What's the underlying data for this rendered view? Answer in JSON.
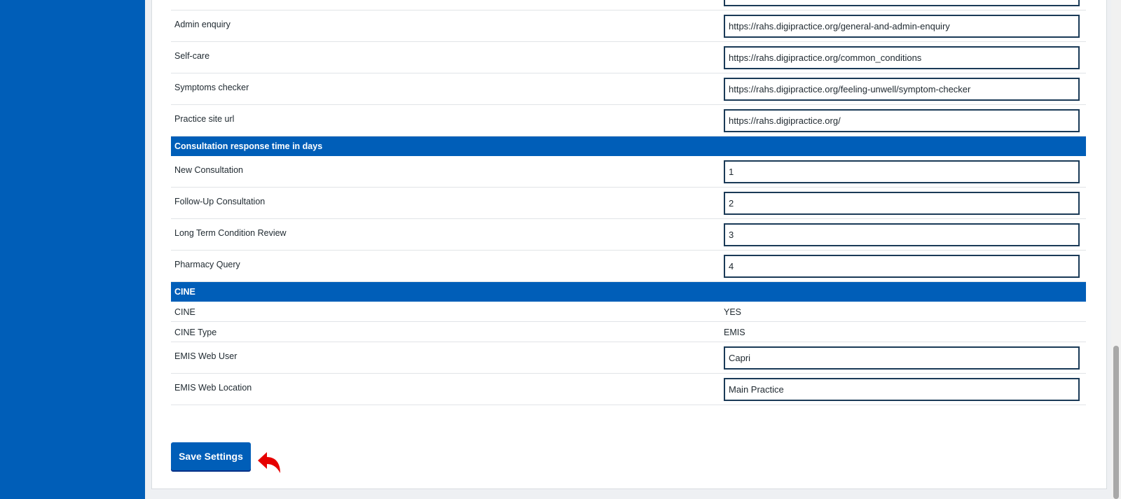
{
  "theme": {
    "primary": "#005eb8",
    "field_border": "#1a3a57",
    "arrow": "#e60000"
  },
  "links": [
    {
      "label": "Admin enquiry",
      "value": "https://rahs.digipractice.org/general-and-admin-enquiry"
    },
    {
      "label": "Self-care",
      "value": "https://rahs.digipractice.org/common_conditions"
    },
    {
      "label": "Symptoms checker",
      "value": "https://rahs.digipractice.org/feeling-unwell/symptom-checker"
    },
    {
      "label": "Practice site url",
      "value": "https://rahs.digipractice.org/"
    }
  ],
  "consultation": {
    "header": "Consultation response time in days",
    "rows": [
      {
        "label": "New Consultation",
        "value": "1"
      },
      {
        "label": "Follow-Up Consultation",
        "value": "2"
      },
      {
        "label": "Long Term Condition Review",
        "value": "3"
      },
      {
        "label": "Pharmacy Query",
        "value": "4"
      }
    ]
  },
  "cine": {
    "header": "CINE",
    "static_rows": [
      {
        "label": "CINE",
        "value": "YES"
      },
      {
        "label": "CINE Type",
        "value": "EMIS"
      }
    ],
    "input_rows": [
      {
        "label": "EMIS Web User",
        "value": "Capri"
      },
      {
        "label": "EMIS Web Location",
        "value": "Main Practice"
      }
    ]
  },
  "actions": {
    "save_label": "Save Settings",
    "pointer_icon": "curved-arrow-icon"
  }
}
